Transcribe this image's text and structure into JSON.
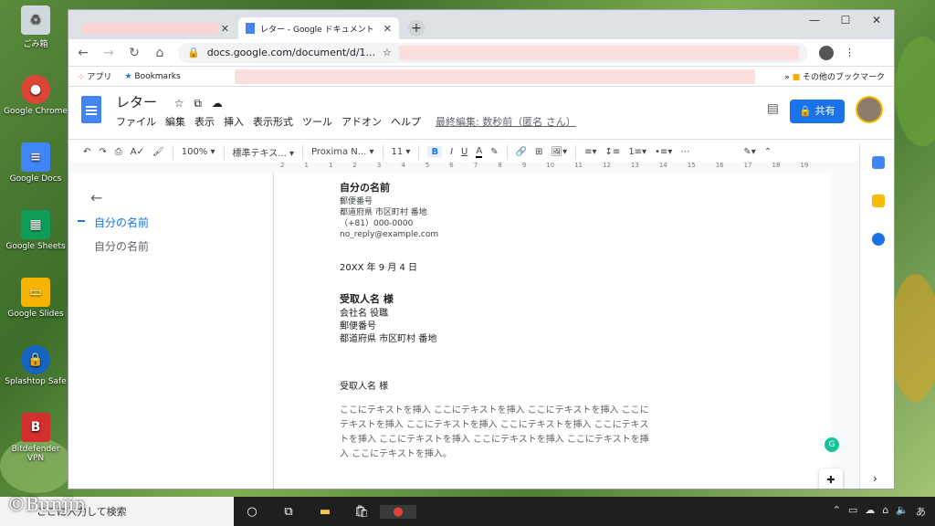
{
  "desktop": {
    "icons": [
      {
        "label": "ごみ箱",
        "color": "#cfd8dc"
      },
      {
        "label": "Google Chrome",
        "color": "#db4437"
      },
      {
        "label": "Google Docs",
        "color": "#4285f4"
      },
      {
        "label": "Google Sheets",
        "color": "#0f9d58"
      },
      {
        "label": "Google Slides",
        "color": "#f4b400"
      },
      {
        "label": "Splashtop Safe",
        "color": "#1565c0"
      },
      {
        "label": "Bitdefender VPN",
        "color": "#d32f2f"
      }
    ],
    "watermark": "©Bunjin"
  },
  "browser": {
    "tab_active_title": "レター - Google ドキュメント",
    "url": "docs.google.com/document/d/1...",
    "bookmarks": {
      "apps": "アプリ",
      "bookmarks": "Bookmarks",
      "other": "その他のブックマーク"
    }
  },
  "doc": {
    "title": "レター",
    "menus": [
      "ファイル",
      "編集",
      "表示",
      "挿入",
      "表示形式",
      "ツール",
      "アドオン",
      "ヘルプ"
    ],
    "last_edit": "最終編集: 数秒前（匿名 さん）",
    "share_label": "共有",
    "toolbar": {
      "zoom": "100%",
      "style": "標準テキス...",
      "font": "Proxima N...",
      "size": "11"
    },
    "ruler": [
      "2",
      "1",
      "1",
      "2",
      "3",
      "4",
      "5",
      "6",
      "7",
      "8",
      "9",
      "10",
      "11",
      "12",
      "13",
      "14",
      "15",
      "16",
      "17",
      "18",
      "19"
    ],
    "outline": [
      "自分の名前",
      "自分の名前"
    ],
    "content": {
      "sender_name": "自分の名前",
      "postal": "郵便番号",
      "address": "都道府県 市区町村 番地",
      "phone": "（+81）000-0000",
      "email": "no_reply@example.com",
      "date": "20XX 年 9 月 4 日",
      "recipient_name": "受取人名 様",
      "company": "会社名 役職",
      "r_postal": "郵便番号",
      "r_address": "都道府県 市区町村 番地",
      "salutation": "受取人名 様",
      "body_lines": [
        "ここにテキストを挿入 ここにテキストを挿入 ここにテキストを挿入 ここに",
        "テキストを挿入 ここにテキストを挿入 ここにテキストを挿入 ここにテキス",
        "トを挿入 ここにテキストを挿入 ここにテキストを挿入 ここにテキストを挿",
        "入 ここにテキストを挿入。"
      ]
    }
  },
  "taskbar": {
    "search_placeholder": "ここに入力して検索"
  }
}
